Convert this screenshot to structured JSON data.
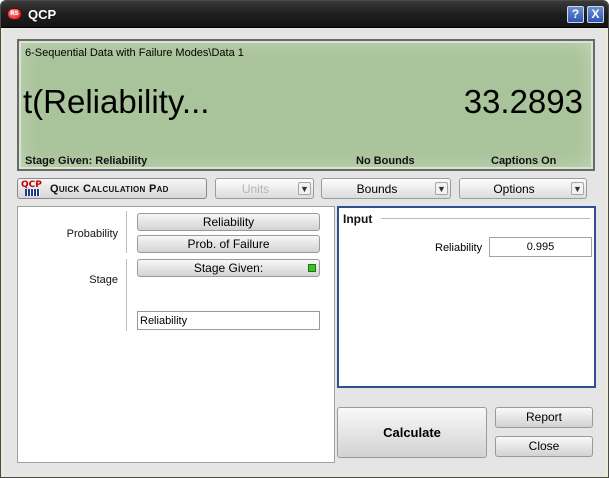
{
  "window": {
    "title": "QCP",
    "icon_text": "RS",
    "help_label": "?",
    "close_label": "X"
  },
  "display": {
    "path": "6-Sequential Data with Failure Modes\\Data 1",
    "main_label": "t(Reliability...",
    "main_value": "33.2893",
    "status_stage": "Stage Given: Reliability",
    "status_bounds": "No Bounds",
    "status_captions": "Captions On"
  },
  "toolbar": {
    "logo_mark": "QCP",
    "logo_label": "Quick Calculation Pad",
    "units_label": "Units",
    "bounds_label": "Bounds",
    "options_label": "Options"
  },
  "left_panel": {
    "probability_label": "Probability",
    "reliability_button": "Reliability",
    "prob_failure_button": "Prob. of Failure",
    "stage_label": "Stage",
    "stage_given_button": "Stage Given:",
    "stage_value": "Reliability"
  },
  "input_panel": {
    "title": "Input",
    "reliability_label": "Reliability",
    "reliability_value": "0.995"
  },
  "actions": {
    "calculate_label": "Calculate",
    "report_label": "Report",
    "close_label": "Close"
  },
  "colors": {
    "lcd_background": "#a9c39a",
    "title_bar": "#1e1e1e",
    "input_panel_border": "#2f4f8f",
    "indicator_green": "#3bbf2b"
  }
}
